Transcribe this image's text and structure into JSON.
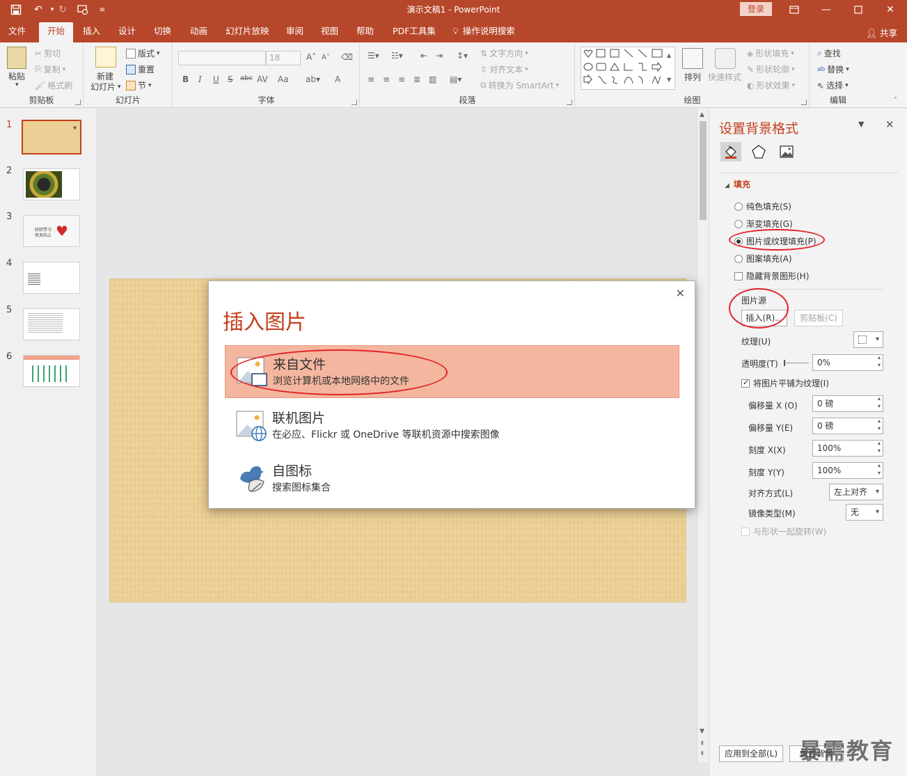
{
  "titlebar": {
    "doc_title": "演示文稿1  -  PowerPoint",
    "login": "登录",
    "icons": [
      "save-icon",
      "undo-icon",
      "redo-icon",
      "start-from-beginning-icon",
      "customize-qat-icon",
      "ribbon-display-options-icon",
      "minimize-icon",
      "maximize-icon",
      "close-icon"
    ]
  },
  "tabs": [
    "文件",
    "开始",
    "插入",
    "设计",
    "切换",
    "动画",
    "幻灯片放映",
    "审阅",
    "视图",
    "帮助",
    "PDF工具集",
    "操作说明搜索"
  ],
  "active_tab": "开始",
  "share": "共享",
  "ribbon": {
    "clipboard": {
      "paste": "粘贴",
      "cut": "剪切",
      "copy": "复制",
      "format_painter": "格式刷",
      "label": "剪贴板"
    },
    "slides": {
      "new_slide_1": "新建",
      "new_slide_2": "幻灯片",
      "layout": "版式",
      "reset": "重置",
      "section": "节",
      "label": "幻灯片"
    },
    "font": {
      "font_size": "18",
      "label": "字体",
      "buttons": [
        "B",
        "I",
        "U",
        "S",
        "abc",
        "AV",
        "Aa",
        "A"
      ]
    },
    "paragraph": {
      "text_direction": "文字方向",
      "align_text": "对齐文本",
      "smartart": "转换为 SmartArt",
      "label": "段落"
    },
    "drawing": {
      "arrange": "排列",
      "quick_styles": "快速样式",
      "shape_fill": "形状填充",
      "shape_outline": "形状轮廓",
      "shape_effects": "形状效果",
      "label": "绘图"
    },
    "editing": {
      "find": "查找",
      "replace": "替换",
      "select": "选择",
      "label": "编辑"
    }
  },
  "thumbnails": [
    "1",
    "2",
    "3",
    "4",
    "5",
    "6"
  ],
  "thumb3_text": [
    "好好学习",
    "天天向上"
  ],
  "dialog": {
    "title": "插入图片",
    "options": [
      {
        "title": "来自文件",
        "desc": "浏览计算机或本地网络中的文件"
      },
      {
        "title": "联机图片",
        "desc": "在必应、Flickr 或 OneDrive 等联机资源中搜索图像"
      },
      {
        "title": "自图标",
        "desc": "搜索图标集合"
      }
    ]
  },
  "format_pane": {
    "title": "设置背景格式",
    "section": "填充",
    "radios": [
      "纯色填充(S)",
      "渐变填充(G)",
      "图片或纹理填充(P)",
      "图案填充(A)"
    ],
    "selected_radio": "图片或纹理填充(P)",
    "hide_bg": "隐藏背景图形(H)",
    "picture_source": "图片源",
    "insert_btn": "插入(R)...",
    "clipboard_btn": "剪贴板(C)",
    "texture": "纹理(U)",
    "transparency_label": "透明度(T)",
    "transparency": "0%",
    "tile": "将图片平铺为纹理(I)",
    "offset_x_label": "偏移量 X (O)",
    "offset_x": "0 磅",
    "offset_y_label": "偏移量 Y(E)",
    "offset_y": "0 磅",
    "scale_x_label": "刻度 X(X)",
    "scale_x": "100%",
    "scale_y_label": "刻度 Y(Y)",
    "scale_y": "100%",
    "align_label": "对齐方式(L)",
    "align": "左上对齐",
    "mirror_label": "镜像类型(M)",
    "mirror": "无",
    "rotate": "与形状一起旋转(W)",
    "apply_all": "应用到全部(L)",
    "reset_bg": "重置背景"
  },
  "watermark": "暴需教育",
  "colors": {
    "accent": "#b7472a",
    "title_red": "#c43e1c",
    "highlight": "#f4b69f",
    "annotation": "#e2232a"
  }
}
